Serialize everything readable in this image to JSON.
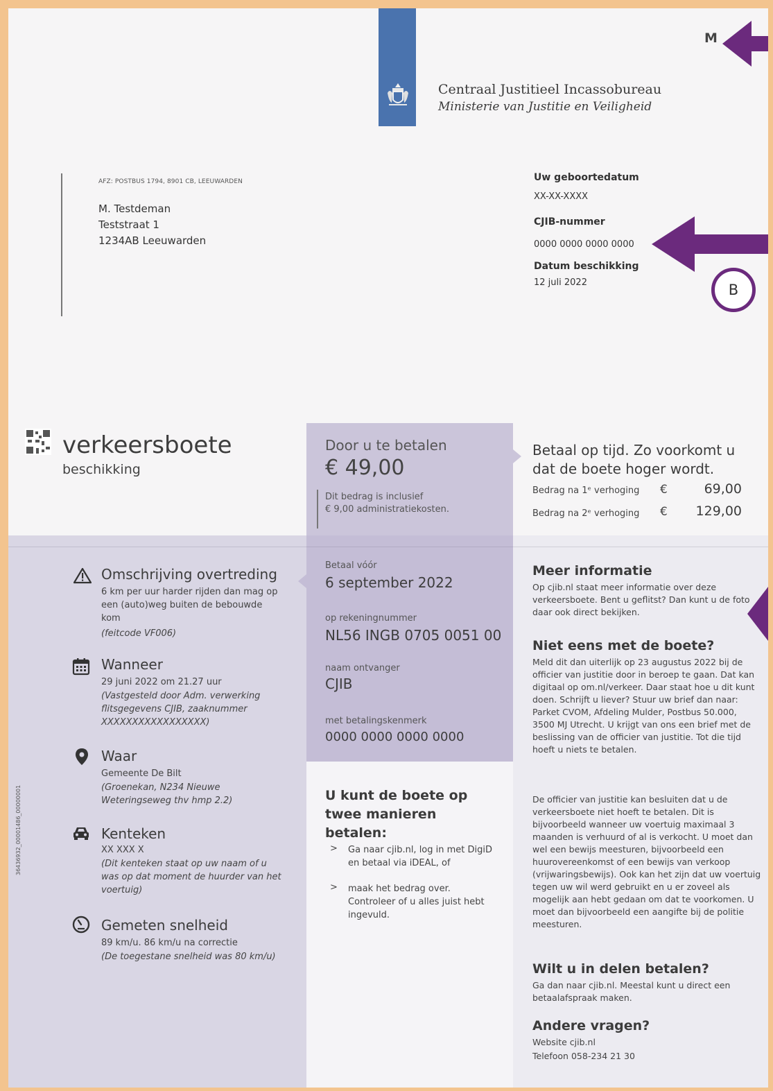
{
  "header": {
    "org_name": "Centraal Justitieel Incassobureau",
    "ministry": "Ministerie van Justitie en Veiligheid",
    "mark_m": "M",
    "badge_b": "B"
  },
  "colors": {
    "accent_purple": "#6b2a7d",
    "logo_blue": "#4a73ae",
    "band_purple": "#c4bdd6"
  },
  "address": {
    "return_address": "AFZ: POSTBUS 1794, 8901 CB, LEEUWARDEN",
    "name": "M. Testdeman",
    "street": "Teststraat 1",
    "city": "1234AB Leeuwarden"
  },
  "meta": {
    "dob_label": "Uw geboortedatum",
    "dob_value": "XX-XX-XXXX",
    "cjib_label": "CJIB-nummer",
    "cjib_value": "0000 0000 0000 0000",
    "decision_label": "Datum beschikking",
    "decision_value": "12 juli 2022"
  },
  "doc": {
    "title": "verkeersboete",
    "subtitle": "beschikking",
    "side_code": "36436932_00001486_00000001"
  },
  "payment": {
    "label": "Door u te betalen",
    "amount": "€ 49,00",
    "note_line1": "Dit bedrag is inclusief",
    "note_line2": "€ 9,00 administratiekosten.",
    "pay_before_label": "Betaal vóór",
    "pay_before_value": "6 september 2022",
    "account_label": "op rekeningnummer",
    "account_value": "NL56 INGB 0705 0051 00",
    "recipient_label": "naam ontvanger",
    "recipient_value": "CJIB",
    "reference_label": "met betalingskenmerk",
    "reference_value": "0000 0000 0000 0000"
  },
  "on_time": {
    "heading": "Betaal op tijd. Zo voorkomt u dat de boete hoger wordt.",
    "row1_label": "Bedrag na 1ᵉ verhoging",
    "row1_currency": "€",
    "row1_value": "69,00",
    "row2_label": "Bedrag na 2ᵉ verhoging",
    "row2_currency": "€",
    "row2_value": "129,00"
  },
  "details": {
    "offence_title": "Omschrijving overtreding",
    "offence_text": "6 km per uur harder rijden dan mag op een (auto)weg buiten de bebouwde kom",
    "offence_code": "(feitcode VF006)",
    "when_title": "Wanneer",
    "when_text": "29 juni 2022 om 21.27 uur",
    "when_note": "(Vastgesteld door Adm. verwerking flitsgegevens CJIB, zaaknummer XXXXXXXXXXXXXXXXX)",
    "where_title": "Waar",
    "where_text": "Gemeente De Bilt",
    "where_note": "(Groenekan, N234 Nieuwe Weteringseweg thv hmp 2.2)",
    "plate_title": "Kenteken",
    "plate_text": "XX XXX X",
    "plate_note": "(Dit kenteken staat op uw naam of u was op dat moment de huurder van het voertuig)",
    "speed_title": "Gemeten snelheid",
    "speed_text": "89 km/u. 86 km/u na correctie",
    "speed_note": "(De toegestane snelheid was 80 km/u)"
  },
  "how_to_pay": {
    "heading": "U kunt de boete op twee manieren betalen:",
    "item1": "Ga naar cjib.nl, log in met DigiD en betaal via iDEAL, of",
    "item2": "maak het bedrag over. Controleer of u alles juist hebt ingevuld.",
    "bullet": ">"
  },
  "info": {
    "more_title": "Meer informatie",
    "more_text": "Op cjib.nl staat meer informatie over deze verkeersboete. Bent u geflitst? Dan kunt u de foto daar ook direct bekijken.",
    "disagree_title": "Niet eens met de boete?",
    "disagree_text": "Meld dit dan uiterlijk op 23 augustus 2022 bij de officier van justitie door in beroep te gaan. Dat kan digitaal op om.nl/verkeer. Daar staat hoe u dit kunt doen. Schrijft u liever? Stuur uw brief dan naar: Parket CVOM, Afdeling Mulder, Postbus 50.000, 3500 MJ Utrecht. U krijgt van ons een brief met de beslissing van de officier van justitie. Tot die tijd hoeft u niets te betalen.",
    "disagree_text2": "De officier van justitie kan besluiten dat u de verkeersboete niet hoeft te betalen. Dit is bijvoorbeeld wanneer uw voertuig maximaal 3 maanden is verhuurd of al is verkocht. U moet dan wel een bewijs meesturen, bijvoorbeeld een huurovereenkomst of een bewijs van verkoop (vrijwaringsbewijs). Ook kan het zijn dat uw voertuig tegen uw wil werd gebruikt en u er zoveel als mogelijk aan hebt gedaan om dat te voorkomen. U moet dan bijvoorbeeld een aangifte bij de politie meesturen.",
    "parts_title": "Wilt u in delen betalen?",
    "parts_text": "Ga dan naar cjib.nl. Meestal kunt u direct een betaalafspraak maken.",
    "other_title": "Andere vragen?",
    "website": "Website  cjib.nl",
    "phone": "Telefoon 058-234 21 30"
  }
}
